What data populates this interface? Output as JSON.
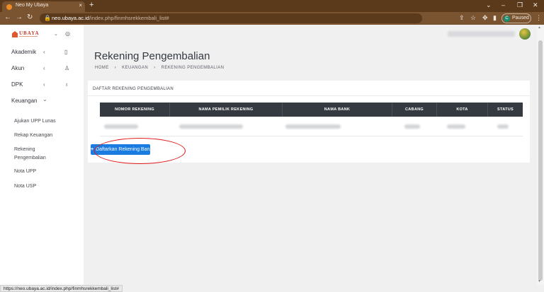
{
  "browser": {
    "tab_title": "Neo My Ubaya",
    "tab_close": "×",
    "new_tab": "+",
    "url_domain": "neo.ubaya.ac.id",
    "url_path": "/index.php/finmhsrekkembali_list#",
    "profile_initial": "C",
    "profile_label": "Paused",
    "status_url": "https://neo.ubaya.ac.id/index.php/finmhsrekkembali_list#"
  },
  "sidebar": {
    "brand": "UBAYA",
    "menu": [
      {
        "label": "Akademik",
        "chevron": "‹",
        "icon": "book-icon"
      },
      {
        "label": "Akun",
        "chevron": "‹",
        "icon": "user-icon"
      },
      {
        "label": "DPK",
        "chevron": "‹",
        "icon": "badge-icon"
      },
      {
        "label": "Keuangan",
        "chevron": "⌄"
      }
    ],
    "submenu": [
      {
        "label": "Ajukan UPP Lunas"
      },
      {
        "label": "Rekap Keuangan"
      },
      {
        "label": "Rekening Pengembalian"
      },
      {
        "label": "Nota UPP"
      },
      {
        "label": "Nota USP"
      }
    ]
  },
  "main": {
    "page_title": "Rekening Pengembalian",
    "breadcrumb": [
      "HOME",
      "›",
      "KEUANGAN",
      "›",
      "REKENING PENGEMBALIAN"
    ],
    "card_title": "DAFTAR REKENING PENGEMBALIAN",
    "table": {
      "columns": [
        "NOMOR REKENING",
        "NAMA PEMILIK REKENING",
        "NAMA BANK",
        "CABANG",
        "KOTA",
        "STATUS"
      ]
    },
    "add_button": {
      "icon": "+",
      "label": "Daftarkan Rekening Baru"
    }
  },
  "colors": {
    "accent": "#1a7be0",
    "table_header": "#343a40",
    "highlight": "#e01b1b",
    "browser_frame": "#7a5330"
  }
}
